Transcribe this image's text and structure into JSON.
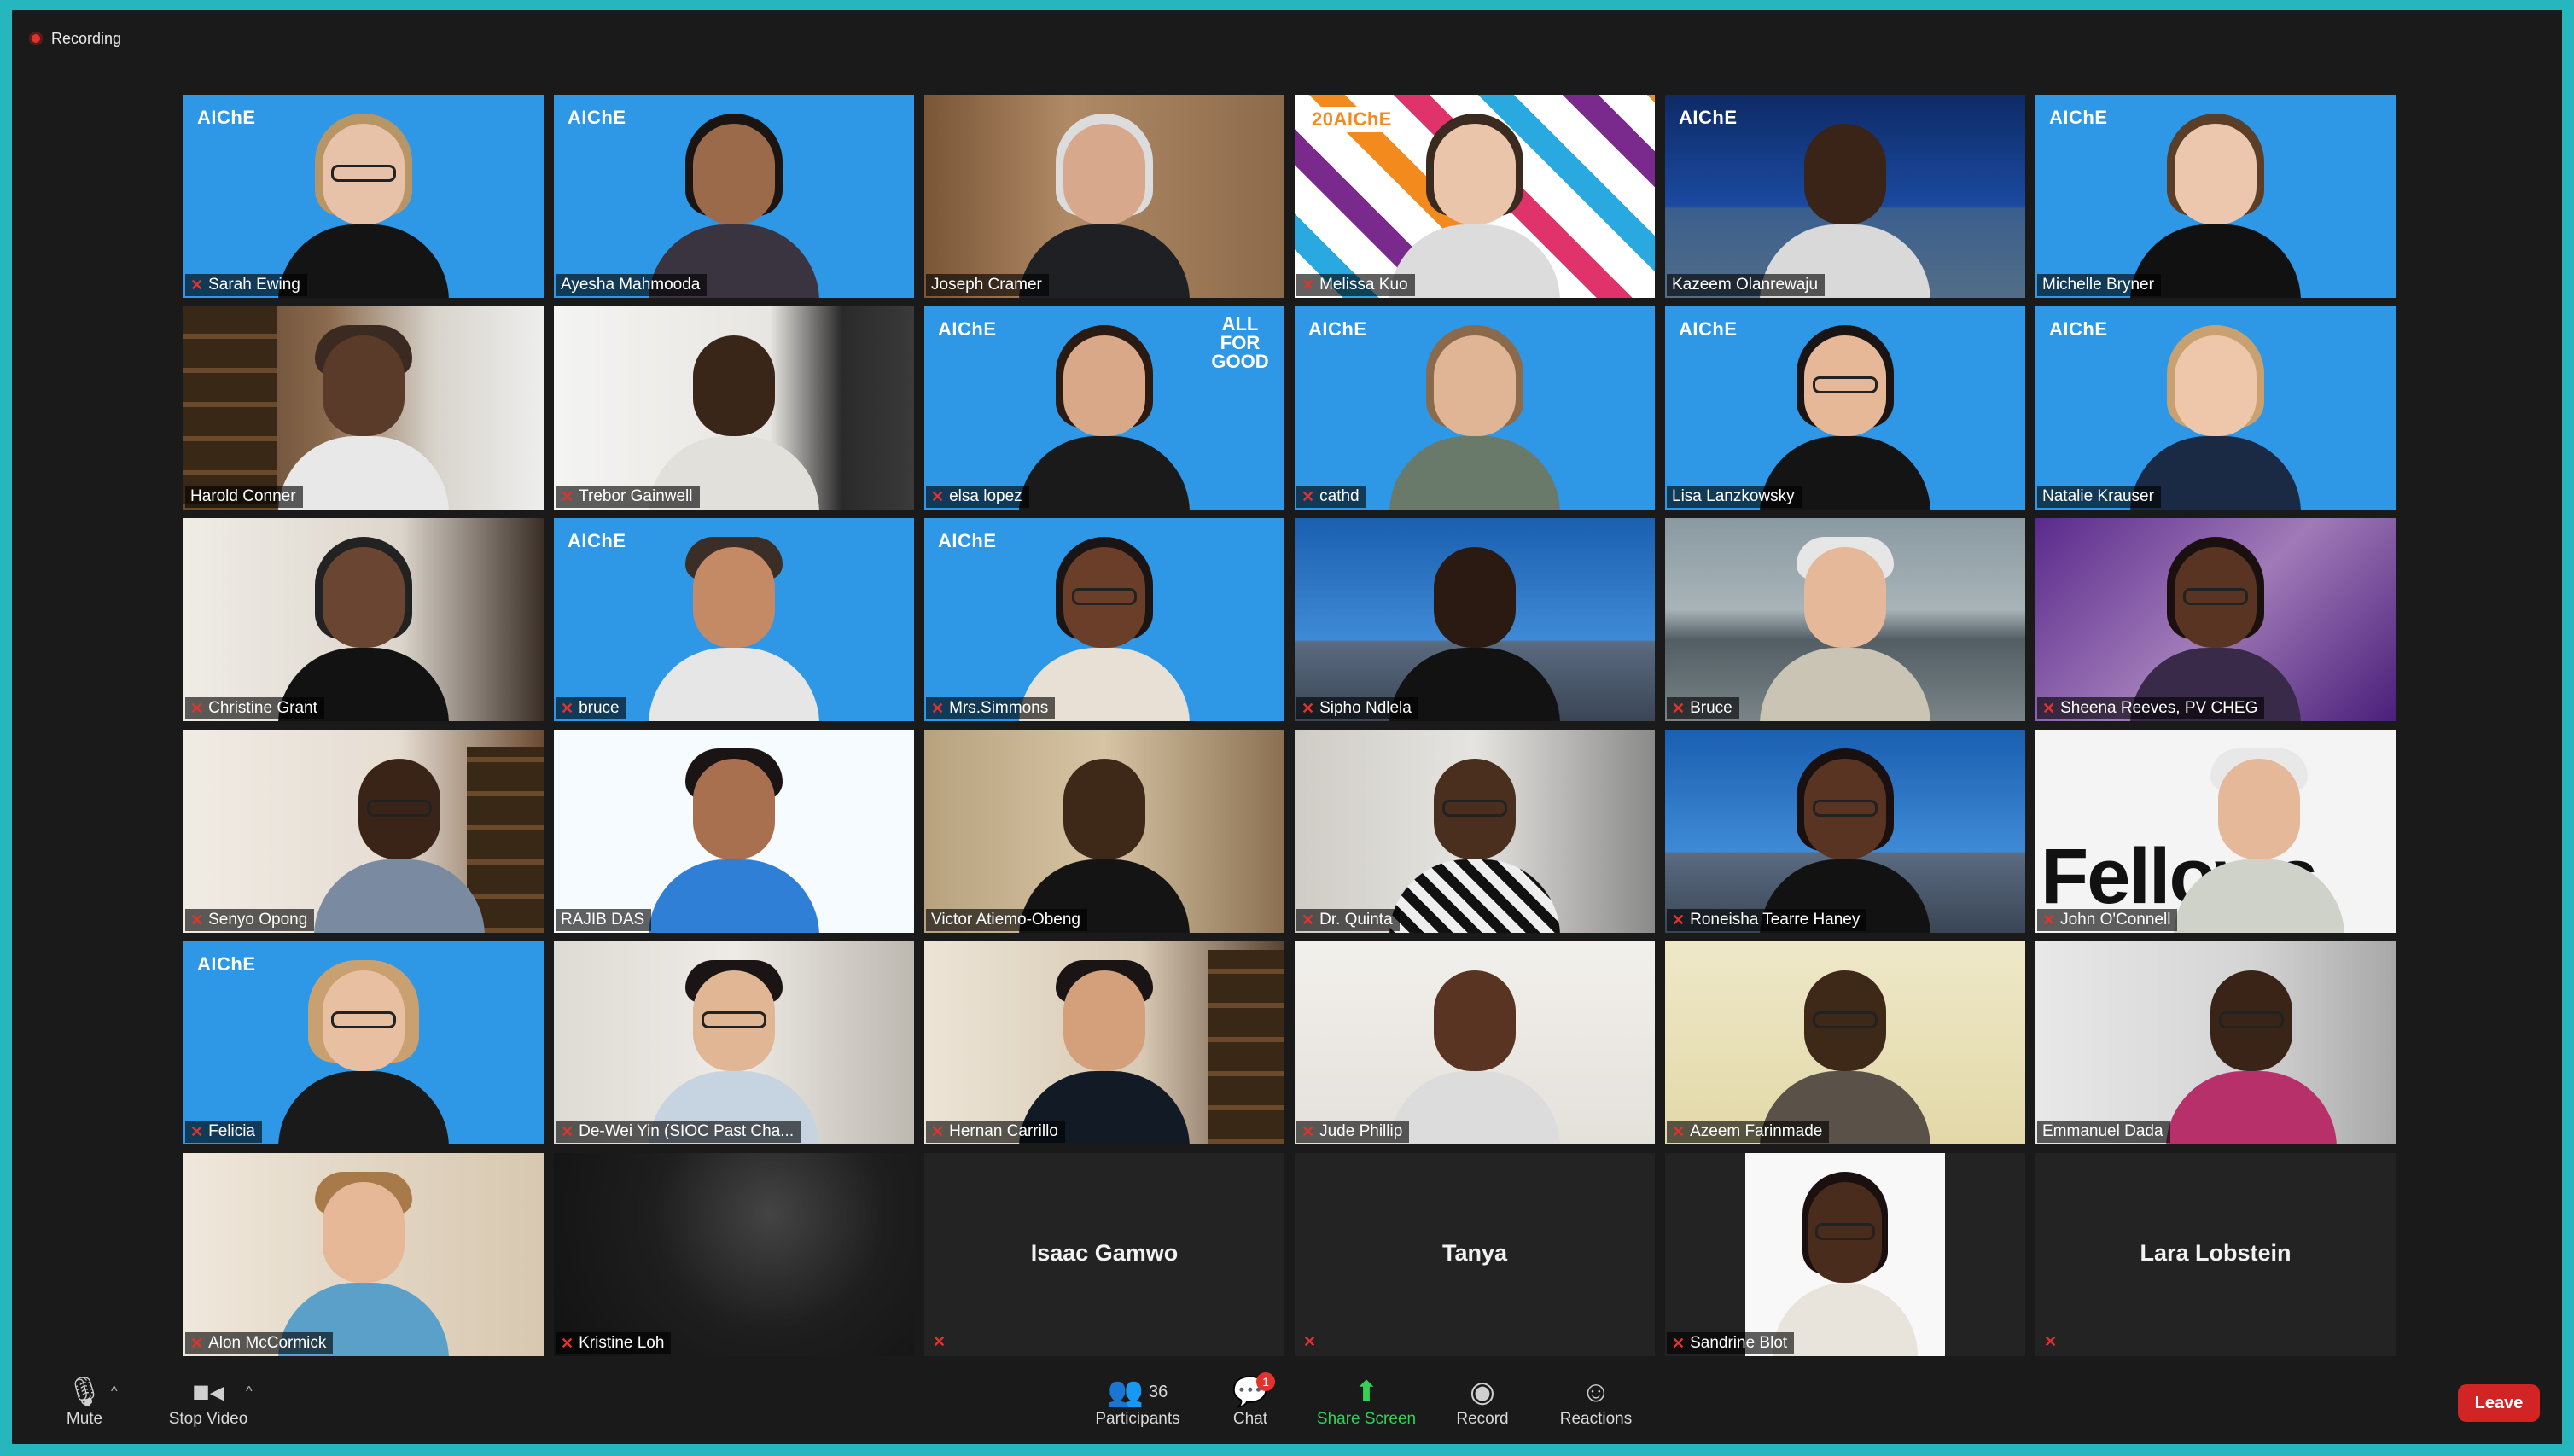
{
  "recording": {
    "label": "Recording"
  },
  "tiles": [
    {
      "name": "Sarah Ewing"
    },
    {
      "name": "Ayesha Mahmooda"
    },
    {
      "name": "Joseph Cramer"
    },
    {
      "name": "Melissa Kuo"
    },
    {
      "name": "Kazeem Olanrewaju"
    },
    {
      "name": "Michelle Bryner"
    },
    {
      "name": "Harold Conner"
    },
    {
      "name": "Trebor Gainwell"
    },
    {
      "name": "elsa lopez"
    },
    {
      "name": "cathd"
    },
    {
      "name": "Lisa Lanzkowsky"
    },
    {
      "name": "Natalie Krauser"
    },
    {
      "name": "Christine Grant"
    },
    {
      "name": "bruce"
    },
    {
      "name": "Mrs.Simmons"
    },
    {
      "name": "Sipho Ndlela"
    },
    {
      "name": "Bruce"
    },
    {
      "name": "Sheena Reeves, PV CHEG"
    },
    {
      "name": "Senyo Opong"
    },
    {
      "name": "RAJIB DAS"
    },
    {
      "name": "Victor Atiemo-Obeng"
    },
    {
      "name": "Dr. Quinta"
    },
    {
      "name": "Roneisha Tearre Haney"
    },
    {
      "name": "John O'Connell"
    },
    {
      "name": "Felicia"
    },
    {
      "name": "De-Wei Yin (SIOC Past Cha..."
    },
    {
      "name": "Hernan Carrillo"
    },
    {
      "name": "Jude Phillip"
    },
    {
      "name": "Azeem Farinmade"
    },
    {
      "name": "Emmanuel Dada"
    },
    {
      "name": "Alon McCormick"
    },
    {
      "name": "Kristine Loh"
    },
    {
      "name": "Isaac Gamwo"
    },
    {
      "name": "Tanya"
    },
    {
      "name": "Sandrine Blot"
    },
    {
      "name": "Lara Lobstein"
    }
  ],
  "branding": {
    "aiche": "AIChE",
    "twenty_aiche": "20AIChE",
    "all_for_good": "ALL FOR GOOD",
    "fellows": "Fellows"
  },
  "toolbar": {
    "mute": "Mute",
    "stop_video": "Stop Video",
    "participants": "Participants",
    "participants_count": "36",
    "chat": "Chat",
    "chat_badge": "1",
    "share_screen": "Share Screen",
    "record": "Record",
    "reactions": "Reactions",
    "leave": "Leave"
  },
  "colors": {
    "aiche_blue": "#2a97e8",
    "share_green": "#35d157",
    "leave_red": "#d22424",
    "active_speaker": "#e4e14c"
  }
}
